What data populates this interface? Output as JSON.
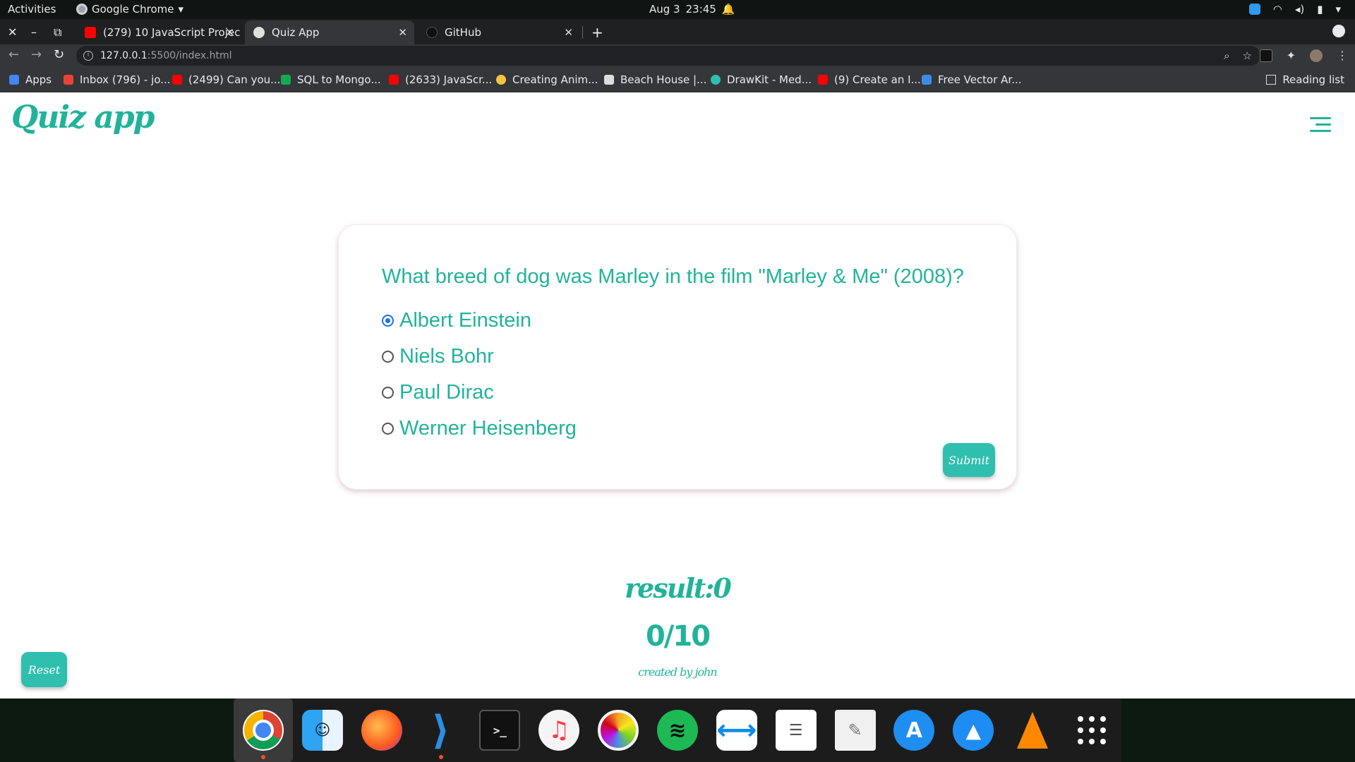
{
  "os": {
    "activities_label": "Activities",
    "app_menu_label": "Google Chrome",
    "date": "Aug 3",
    "time": "23:45"
  },
  "browser": {
    "tabs": [
      {
        "title": "(279) 10 JavaScript Projec",
        "favicon": "youtube-icon",
        "active": false
      },
      {
        "title": "Quiz App",
        "favicon": "globe-icon",
        "active": true
      },
      {
        "title": "GitHub",
        "favicon": "github-icon",
        "active": false
      }
    ],
    "url_host": "127.0.0.1",
    "url_path": ":5500/index.html",
    "bookmarks": [
      {
        "label": "Apps",
        "icon": "apps-grid-icon"
      },
      {
        "label": "Inbox (796) - jo...",
        "icon": "gmail-icon"
      },
      {
        "label": "(2499) Can you...",
        "icon": "youtube-icon"
      },
      {
        "label": "SQL to Mongo...",
        "icon": "mongodb-icon"
      },
      {
        "label": "(2633) JavaScr...",
        "icon": "youtube-icon"
      },
      {
        "label": "Creating Anim...",
        "icon": "emoji-icon"
      },
      {
        "label": "Beach House |...",
        "icon": "beach-house-icon"
      },
      {
        "label": "DrawKit - Med...",
        "icon": "drawkit-icon"
      },
      {
        "label": "(9) Create an I...",
        "icon": "youtube-icon"
      },
      {
        "label": "Free Vector Ar...",
        "icon": "vecteezy-icon"
      }
    ],
    "reading_list_label": "Reading list"
  },
  "page": {
    "logo": "Quiz app",
    "question": "What breed of dog was Marley in the film \"Marley & Me\" (2008)?",
    "options": [
      {
        "label": "Albert Einstein",
        "checked": true
      },
      {
        "label": "Niels Bohr",
        "checked": false
      },
      {
        "label": "Paul Dirac",
        "checked": false
      },
      {
        "label": "Werner Heisenberg",
        "checked": false
      }
    ],
    "submit_label": "Submit",
    "result_text": "result:0",
    "score_text": "0/10",
    "credit_text": "created by john",
    "reset_label": "Reset",
    "accent_color": "#21b39a",
    "button_color": "#2fbfae"
  },
  "dock": {
    "apps": [
      "chrome-icon",
      "finder-icon",
      "firefox-icon",
      "vscode-icon",
      "terminal-icon",
      "music-icon",
      "photos-icon",
      "spotify-icon",
      "teamviewer-icon",
      "notes-icon",
      "text-editor-icon",
      "app-store-icon",
      "send-icon",
      "vlc-icon",
      "show-applications-icon"
    ]
  }
}
